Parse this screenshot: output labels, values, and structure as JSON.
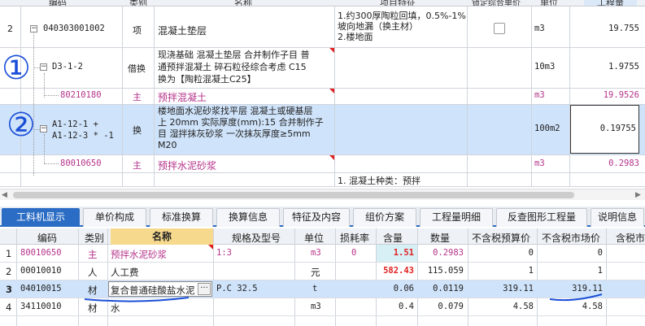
{
  "top_grid": {
    "headers": [
      "编码",
      "类别",
      "名称",
      "项目特征",
      "锁定综合单价",
      "单位",
      "工程量"
    ],
    "rows": [
      {
        "seq": "2",
        "code": "040303001002",
        "type": "项",
        "name": "混凝土垫层",
        "feature_lines": [
          "1.约300厚陶粒回填，0.5%-1%",
          "坡向地漏（换主材）",
          "2.楼地面"
        ],
        "unit": "m3",
        "qty": "19.755"
      },
      {
        "seq": "",
        "code": "D3-1-2",
        "type": "借换",
        "name_lines": [
          "现浇基础 混凝土垫层 合并制作子目 普",
          "通预拌混凝土 碎石粒径综合考虑 C15",
          "换为【陶粒混凝土C25】"
        ],
        "unit": "10m3",
        "qty": "1.9755"
      },
      {
        "seq": "",
        "code": "80210180",
        "type": "主",
        "name": "预拌混凝土",
        "unit": "m3",
        "qty": "19.9526"
      },
      {
        "seq": "",
        "code_lines": [
          "A1-12-1 +",
          "A1-12-3 * -1"
        ],
        "type": "换",
        "name_lines": [
          "楼地面水泥砂浆找平层 混凝土或硬基层",
          "上 20mm 实际厚度(mm):15 合并制作子",
          "目 湿拌抹灰砂浆 一次抹灰厚度≥5mm",
          "M20"
        ],
        "unit": "100m2",
        "qty": "0.19755"
      },
      {
        "seq": "",
        "code": "80010650",
        "type": "主",
        "name": "预拌水泥砂浆",
        "unit": "m3",
        "qty": "0.2983"
      },
      {
        "seq": "",
        "code": "",
        "type": "",
        "name": "",
        "feature": "1. 混凝土种类：预拌",
        "unit": "",
        "qty": ""
      }
    ]
  },
  "annotations": {
    "mark1": "①",
    "mark2": "②"
  },
  "tabs": [
    "工料机显示",
    "单价构成",
    "标准换算",
    "换算信息",
    "特征及内容",
    "组价方案",
    "工程量明细",
    "反查图形工程量",
    "说明信息"
  ],
  "bottom_grid": {
    "headers": [
      "编码",
      "类别",
      "名称",
      "规格及型号",
      "单位",
      "损耗率",
      "含量",
      "数量",
      "不含税预算价",
      "不含税市场价",
      "含税市"
    ],
    "rows": [
      {
        "seq": "1",
        "code": "80010650",
        "type": "主",
        "name": "预拌水泥砂浆",
        "spec": "1:3",
        "unit": "m3",
        "loss": "0",
        "content": "1.51",
        "qty": "0.2983",
        "budget": "0",
        "market": "0"
      },
      {
        "seq": "2",
        "code": "00010010",
        "type": "人",
        "name": "人工费",
        "spec": "",
        "unit": "元",
        "loss": "",
        "content": "582.43",
        "qty": "115.059",
        "budget": "1",
        "market": "1"
      },
      {
        "seq": "3",
        "code": "04010015",
        "type": "材",
        "name": "复合普通硅酸盐水泥",
        "spec": "P.C 32.5",
        "unit": "t",
        "loss": "",
        "content": "0.06",
        "qty": "0.0119",
        "budget": "319.11",
        "market": "319.11"
      },
      {
        "seq": "4",
        "code": "34110010",
        "type": "材",
        "name": "水",
        "spec": "",
        "unit": "m3",
        "loss": "",
        "content": "0.4",
        "qty": "0.079",
        "budget": "4.58",
        "market": "4.58"
      }
    ]
  },
  "colors": {
    "selected_row": "#cfe3fa",
    "pink_text": "#b5338a",
    "red_text": "#e02020",
    "tab_active": "#2b6cc4",
    "annotation": "#1a4fd8"
  }
}
